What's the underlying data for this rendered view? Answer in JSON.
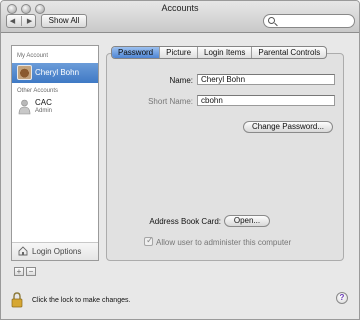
{
  "window": {
    "title": "Accounts"
  },
  "toolbar": {
    "show_all": "Show All",
    "search_placeholder": ""
  },
  "sidebar": {
    "my_account_header": "My Account",
    "other_accounts_header": "Other Accounts",
    "selected_account": {
      "name": "Cheryl Bohn"
    },
    "other_accounts": [
      {
        "name": "CAC",
        "role": "Admin"
      }
    ],
    "login_options": "Login Options",
    "add_label": "+",
    "remove_label": "−"
  },
  "tabs": [
    {
      "label": "Password",
      "active": true
    },
    {
      "label": "Picture",
      "active": false
    },
    {
      "label": "Login Items",
      "active": false
    },
    {
      "label": "Parental Controls",
      "active": false
    }
  ],
  "form": {
    "name_label": "Name:",
    "name_value": "Cheryl Bohn",
    "short_name_label": "Short Name:",
    "short_name_value": "cbohn",
    "change_password": "Change Password...",
    "address_book_label": "Address Book Card:",
    "open_button": "Open...",
    "admin_checkbox_label": "Allow user to administer this computer",
    "admin_checked": true
  },
  "footer": {
    "lock_text": "Click the lock to make changes.",
    "help": "?"
  }
}
